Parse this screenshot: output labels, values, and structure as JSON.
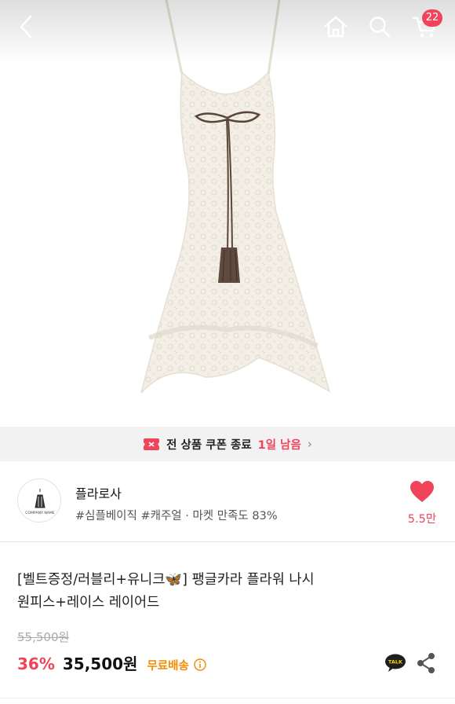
{
  "header": {
    "cart_count": "22"
  },
  "coupon_banner": {
    "text": "전 상품 쿠폰 종료",
    "highlight": "1일 남음",
    "arrow": "›"
  },
  "shop": {
    "logo_text": "COMPANY NAME",
    "name": "플라로사",
    "tags": "#심플베이직 #캐주얼 · 마켓 만족도 83%",
    "like_count": "5.5만"
  },
  "product": {
    "title_line1": "[벨트증정/러블리+유니크🦋] 팽글카라 플라워 나시",
    "title_line2": "원피스+레이스 레이어드",
    "original_price": "55,500원",
    "discount": "36%",
    "price": "35,500원",
    "shipping": "무료배송"
  },
  "colors": {
    "accent": "#f0445b",
    "shipping": "#f28b00",
    "banner_bg": "#f2f2f2"
  },
  "icons": {
    "back": "back-arrow-icon",
    "home": "home-icon",
    "search": "search-icon",
    "cart": "cart-icon",
    "coupon": "coupon-icon",
    "like": "heart-icon",
    "talk": "talk-icon",
    "share": "share-icon",
    "info": "info-icon"
  }
}
